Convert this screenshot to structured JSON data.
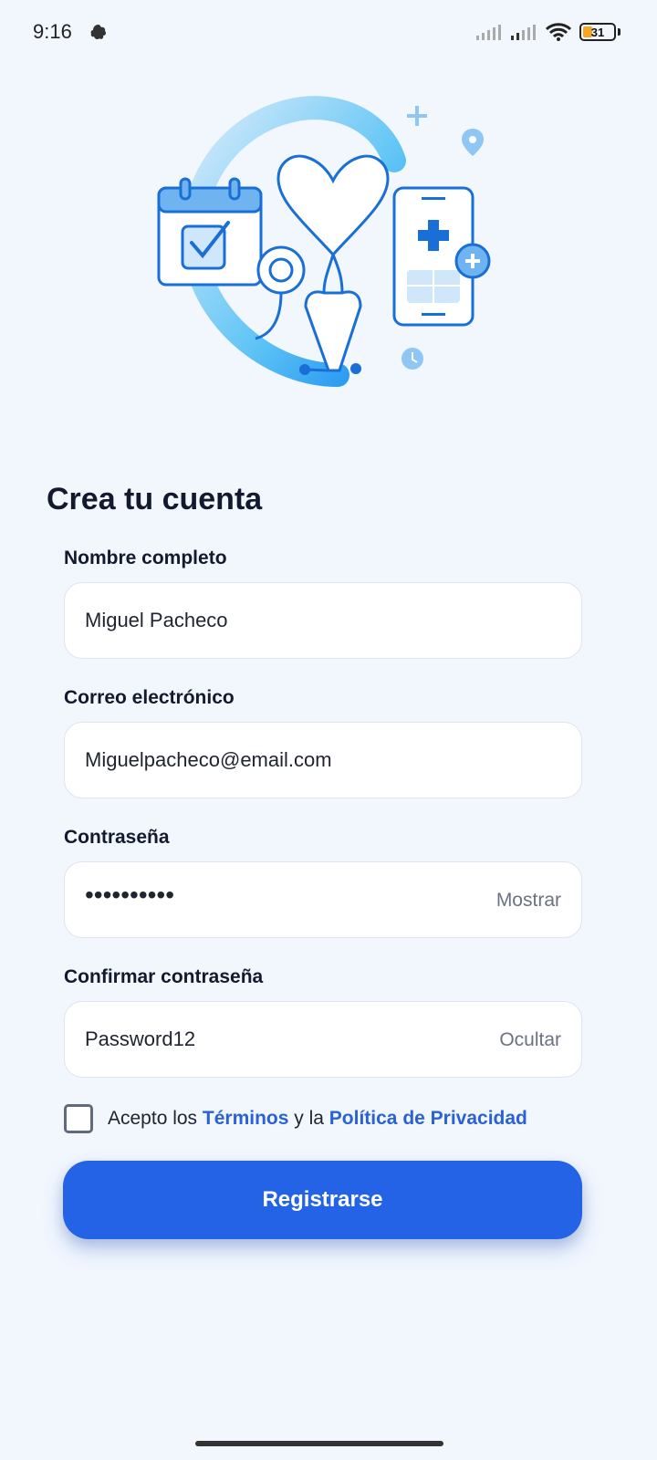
{
  "status_bar": {
    "time": "9:16",
    "battery": "31"
  },
  "form": {
    "title": "Crea tu cuenta",
    "full_name": {
      "label": "Nombre completo",
      "value": "Miguel Pacheco"
    },
    "email": {
      "label": "Correo electrónico",
      "value": "Miguelpacheco@email.com"
    },
    "password": {
      "label": "Contraseña",
      "value": "••••••••••",
      "toggle": "Mostrar"
    },
    "confirm_password": {
      "label": "Confirmar contraseña",
      "value": "Password12",
      "toggle": "Ocultar"
    },
    "terms": {
      "prefix": "Acepto los ",
      "terms_link": "Términos",
      "middle": " y la ",
      "privacy_link": "Política de Privacidad",
      "checked": false
    },
    "submit_label": "Registrarse"
  },
  "colors": {
    "accent": "#2563e6",
    "link": "#2a62d6",
    "background": "#f2f6fd"
  },
  "icons": [
    "notification-icon",
    "signal-icon",
    "wifi-icon",
    "battery-icon",
    "calendar-icon",
    "stethoscope-icon",
    "heart-icon",
    "phone-medical-icon",
    "location-pin-icon",
    "clock-icon",
    "plus-icon"
  ]
}
